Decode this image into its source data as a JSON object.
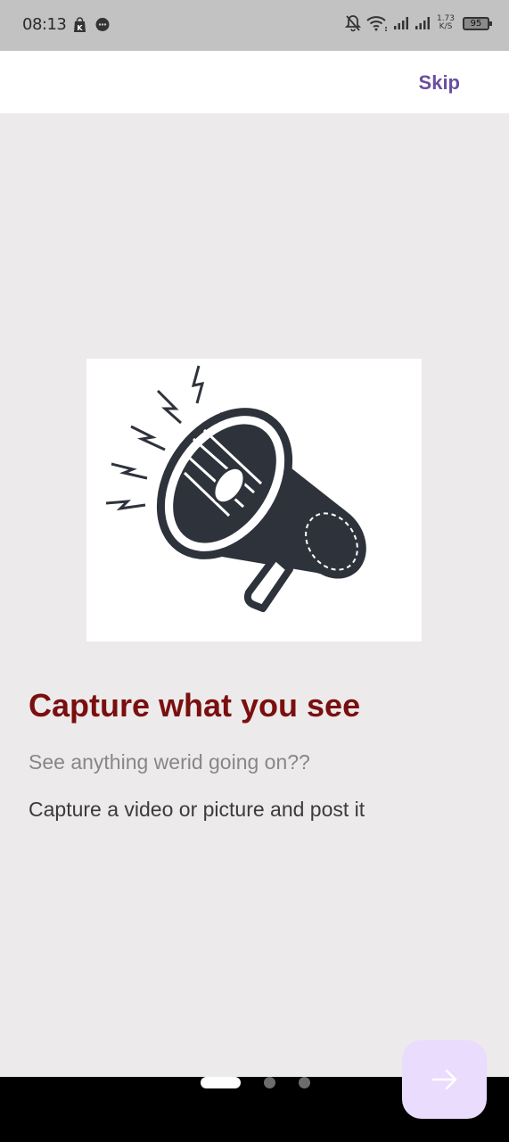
{
  "status_bar": {
    "time": "08:13",
    "net_speed_value": "1.73",
    "net_speed_unit": "K/S",
    "battery": "95"
  },
  "app_bar": {
    "skip_label": "Skip"
  },
  "onboarding": {
    "illustration": "megaphone-illustration",
    "title": "Capture what you see",
    "subtitle": "See anything werid going on??",
    "description": "Capture a video or picture and post it",
    "page_indicator": {
      "total": 3,
      "active": 1
    }
  },
  "next_button": {
    "icon": "arrow-right-icon"
  },
  "colors": {
    "title": "#7a0f0f",
    "skip": "#6a4ea0",
    "next_button_bg": "#eadcfc",
    "background": "#edeaeb"
  }
}
